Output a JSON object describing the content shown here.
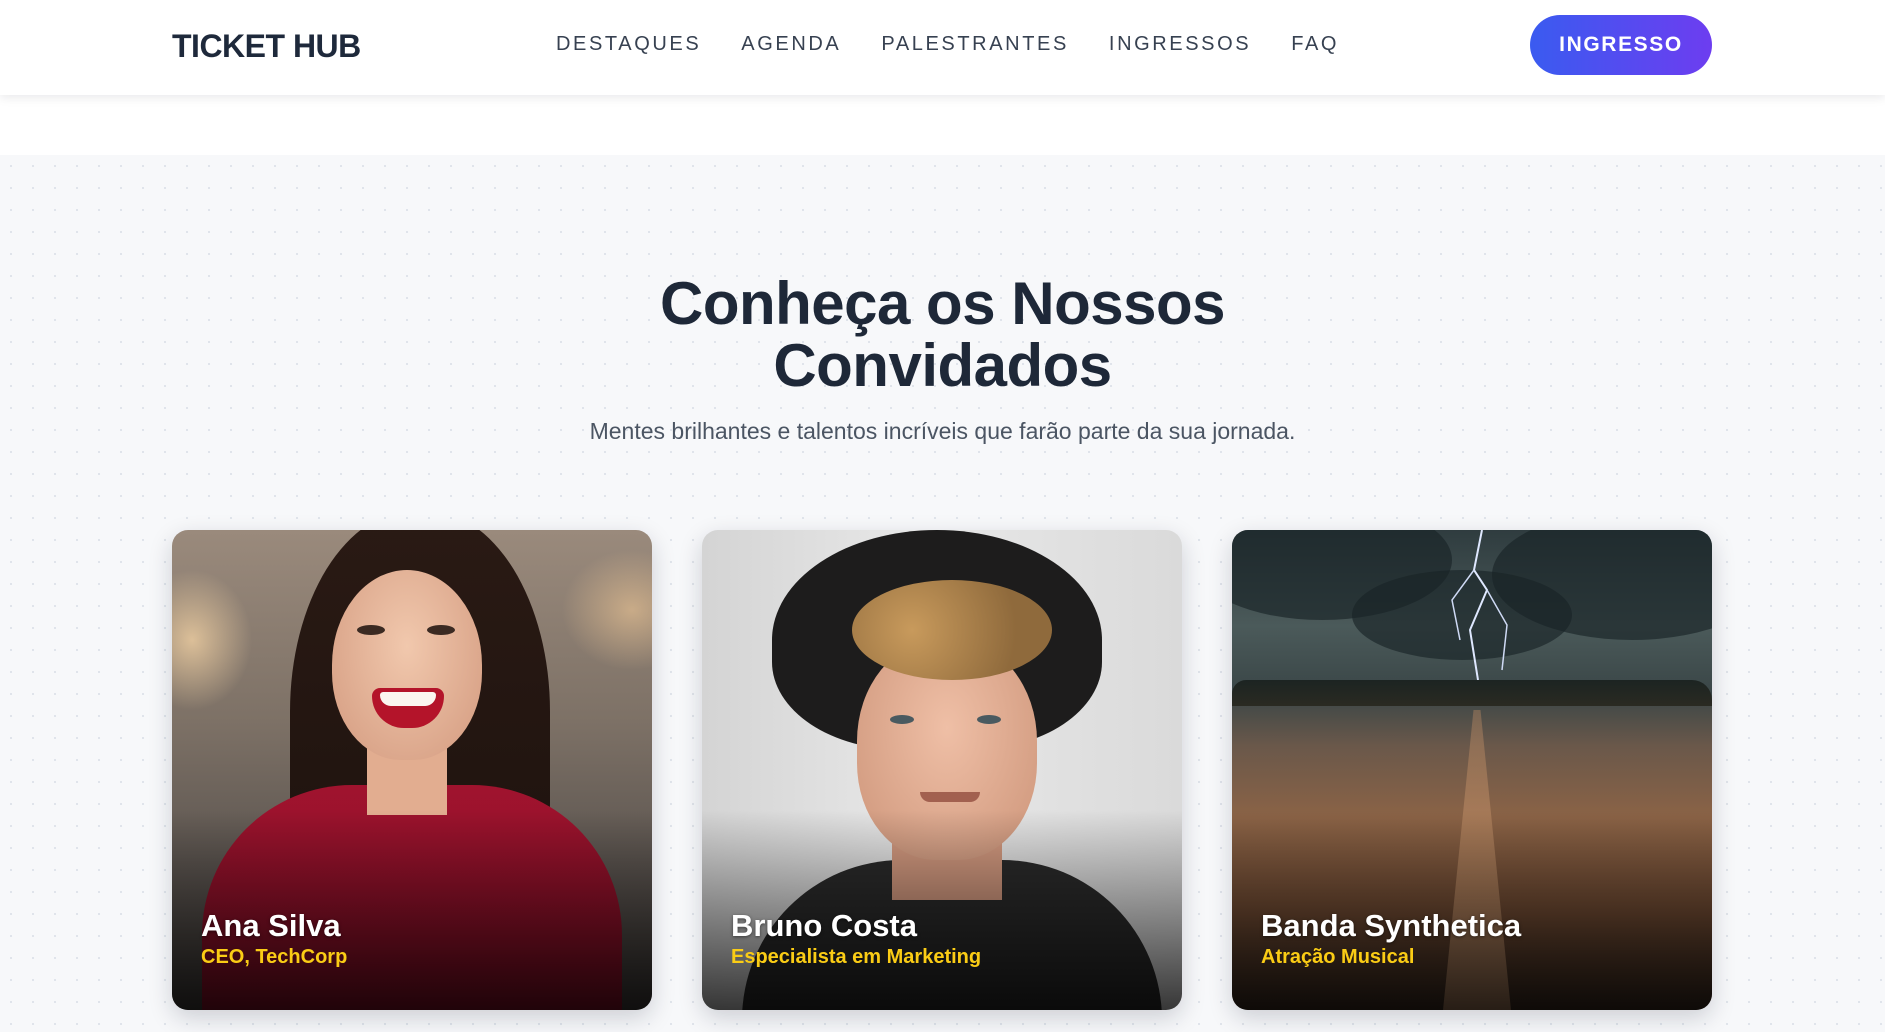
{
  "header": {
    "logo": "TICKET HUB",
    "nav": [
      "DESTAQUES",
      "AGENDA",
      "PALESTRANTES",
      "INGRESSOS",
      "FAQ"
    ],
    "cta_label": "INGRESSO"
  },
  "speakers": {
    "title_line1": "Conheça os Nossos",
    "title_line2": "Convidados",
    "subtitle": "Mentes brilhantes e talentos incríveis que farão parte da sua jornada.",
    "cards": [
      {
        "name": "Ana Silva",
        "role": "CEO, TechCorp",
        "image": "woman-smiling-red-sweater-photo"
      },
      {
        "name": "Bruno Costa",
        "role": "Especialista em Marketing",
        "image": "man-with-black-hat-photo"
      },
      {
        "name": "Banda Synthetica",
        "role": "Atração Musical",
        "image": "stormy-field-lightning-photo"
      }
    ]
  },
  "colors": {
    "accent_gradient_start": "#3a5bf0",
    "accent_gradient_end": "#6d3df0",
    "role_text": "#facc15",
    "section_background": "#f7f8fa"
  }
}
